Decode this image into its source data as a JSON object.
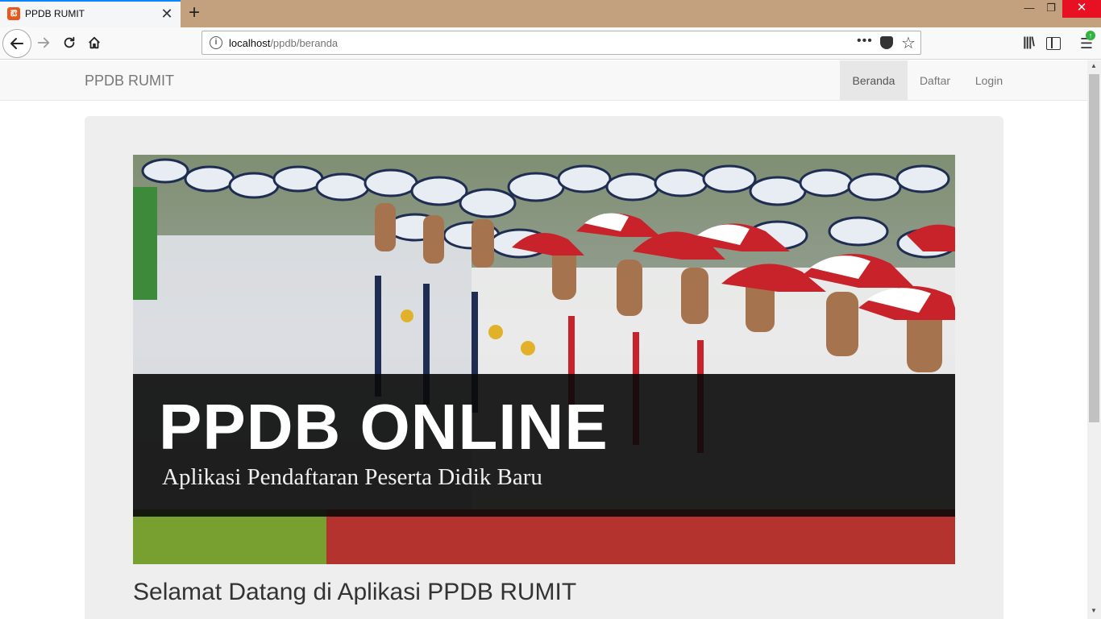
{
  "browser": {
    "tab_title": "PPDB RUMIT",
    "tab_close": "✕",
    "new_tab": "+",
    "url_host": "localhost",
    "url_path": "/ppdb/beranda",
    "window": {
      "minimize": "—",
      "maximize": "❐",
      "close": "✕"
    }
  },
  "site": {
    "brand": "PPDB RUMIT",
    "nav": [
      {
        "label": "Beranda",
        "active": true
      },
      {
        "label": "Daftar",
        "active": false
      },
      {
        "label": "Login",
        "active": false
      }
    ]
  },
  "banner": {
    "title": "PPDB ONLINE",
    "subtitle": "Aplikasi Pendaftaran Peserta Didik Baru"
  },
  "welcome": "Selamat Datang di Aplikasi PPDB RUMIT",
  "colors": {
    "tab_strip": "#c3a07e",
    "active_nav": "#e7e7e7",
    "jumbotron": "#eeeeee",
    "cap_red": "#c8232b",
    "cap_navy": "#1f2d52"
  },
  "icons": [
    "back-arrow-icon",
    "forward-arrow-icon",
    "reload-icon",
    "home-icon",
    "info-icon",
    "more-icon",
    "pocket-icon",
    "bookmark-star-icon",
    "library-icon",
    "sidebar-icon",
    "menu-icon"
  ]
}
